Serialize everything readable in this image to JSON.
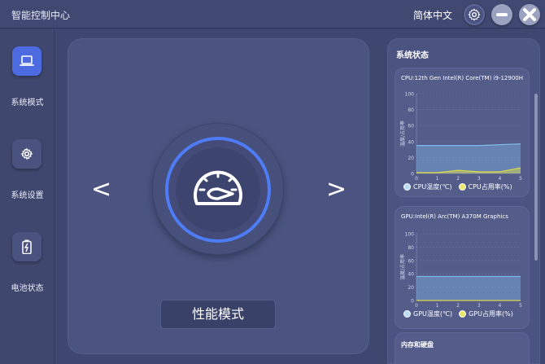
{
  "app": {
    "title": "智能控制中心",
    "language": "简体中文"
  },
  "window_controls": [
    {
      "icon": "gear-icon"
    },
    {
      "icon": "minimize-icon"
    },
    {
      "icon": "close-icon"
    }
  ],
  "sidebar": {
    "items": [
      {
        "label": "系统模式",
        "icon": "laptop-icon",
        "active": true
      },
      {
        "label": "系统设置",
        "icon": "gear-icon",
        "active": false
      },
      {
        "label": "电池状态",
        "icon": "battery-icon",
        "active": false
      }
    ]
  },
  "main": {
    "prev_label": "<",
    "next_label": ">",
    "mode_icon": "speedometer-icon",
    "mode_label": "性能模式"
  },
  "status": {
    "title": "系统状态",
    "memory_title": "内存和硬盘"
  },
  "colors": {
    "accent": "#4d7cf5",
    "temp_series": "#7eb4e6",
    "usage_series": "#d8d84a"
  },
  "chart_data": [
    {
      "type": "area",
      "title": "CPU:12th Gen Intel(R) Core(TM) i9-12900H",
      "ylabel": "温度/占用率",
      "x": [
        0,
        1,
        2,
        3,
        4,
        5
      ],
      "ylim": [
        0,
        100
      ],
      "yticks": [
        0,
        20,
        40,
        60,
        80,
        100
      ],
      "series": [
        {
          "name": "CPU温度(℃)",
          "values": [
            35,
            35,
            35,
            35,
            36,
            37
          ]
        },
        {
          "name": "CPU占用率(%)",
          "values": [
            1,
            1,
            4,
            2,
            2,
            7
          ]
        }
      ]
    },
    {
      "type": "area",
      "title": "GPU:Intel(R) Arc(TM) A370M Graphics",
      "ylabel": "温度/占用率",
      "x": [
        0,
        1,
        2,
        3,
        4,
        5
      ],
      "ylim": [
        0,
        100
      ],
      "yticks": [
        0,
        20,
        40,
        60,
        80,
        100
      ],
      "series": [
        {
          "name": "GPU温度(℃)",
          "values": [
            36,
            36,
            36,
            36,
            36,
            36
          ]
        },
        {
          "name": "GPU占用率(%)",
          "values": [
            0,
            0,
            0,
            0,
            0,
            0
          ]
        }
      ]
    }
  ]
}
